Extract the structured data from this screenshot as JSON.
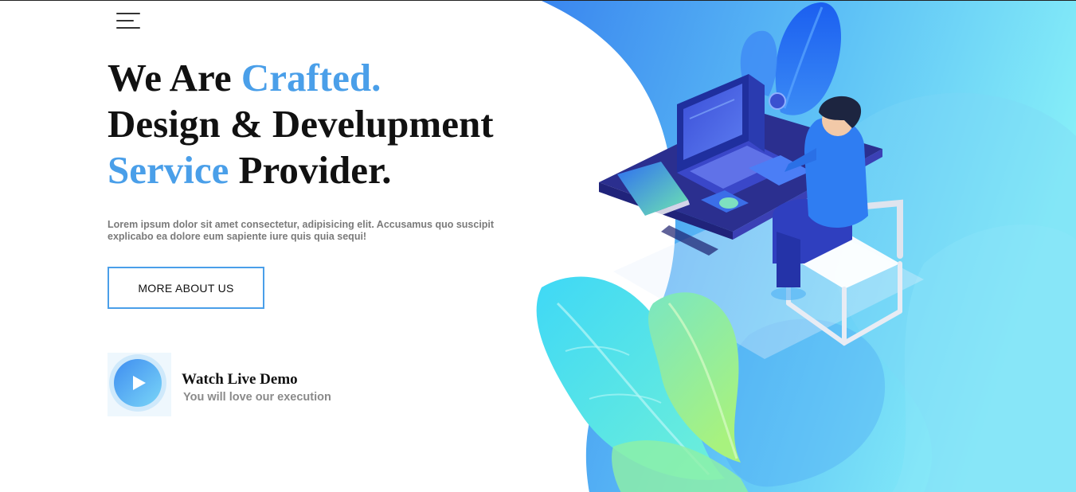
{
  "nav": {
    "menu_icon": "hamburger-menu-icon"
  },
  "hero": {
    "line1_prefix": "We Are ",
    "line1_accent": "Crafted.",
    "line2": "Design & Develupment",
    "line3_accent": "Service",
    "line3_suffix": " Provider.",
    "description": "Lorem ipsum dolor sit amet consectetur, adipisicing elit. Accusamus quo suscipit explicabo ea dolore eum sapiente iure quis quia sequi!",
    "cta_label": "MORE ABOUT US",
    "illustration_icon": "developer-at-laptop-illustration"
  },
  "demo": {
    "play_icon": "play-icon",
    "title": "Watch Live Demo",
    "subtitle": "You will love our execution"
  },
  "colors": {
    "accent": "#4a9fe9",
    "heading": "#111111",
    "muted_text": "#7a7a7a",
    "gradient_start": "#3d8cf0",
    "gradient_end": "#86f0f7",
    "leaf_cyan": "#4fe0f5",
    "leaf_green": "#8ef0a5",
    "desk_navy": "#2b2f8f"
  }
}
